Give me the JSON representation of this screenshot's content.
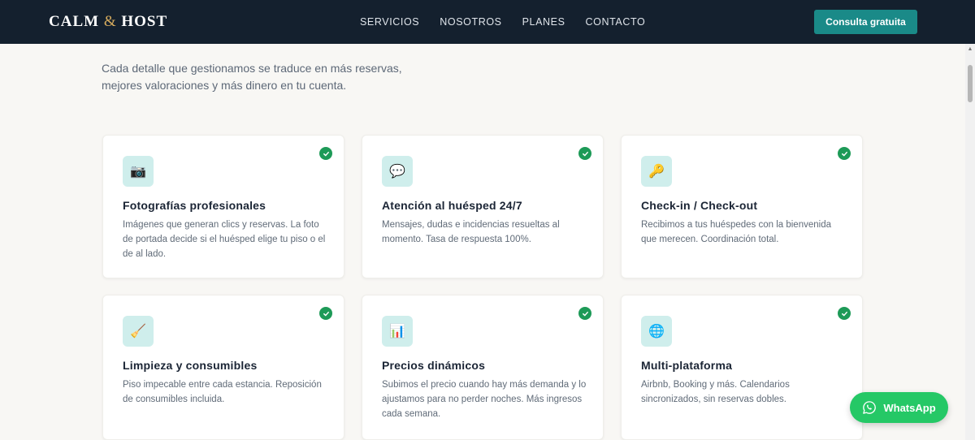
{
  "header": {
    "brand_left": "CALM",
    "brand_amp": "&",
    "brand_right": "HOST",
    "nav": [
      "SERVICIOS",
      "NOSOTROS",
      "PLANES",
      "CONTACTO"
    ],
    "cta_label": "Consulta gratuita"
  },
  "intro": {
    "text": "Cada detalle que gestionamos se traduce en más reservas, mejores valoraciones y más dinero en tu cuenta."
  },
  "cards": [
    {
      "icon": "camera-icon",
      "glyph": "📷",
      "title": "Fotografías profesionales",
      "desc": "Imágenes que generan clics y reservas. La foto de portada decide si el huésped elige tu piso o el de al lado."
    },
    {
      "icon": "speech-bubble-icon",
      "glyph": "💬",
      "title": "Atención al huésped 24/7",
      "desc": "Mensajes, dudas e incidencias resueltas al momento. Tasa de respuesta 100%."
    },
    {
      "icon": "key-icon",
      "glyph": "🔑",
      "title": "Check-in / Check-out",
      "desc": "Recibimos a tus huéspedes con la bienvenida que merecen. Coordinación total."
    },
    {
      "icon": "broom-icon",
      "glyph": "🧹",
      "title": "Limpieza y consumibles",
      "desc": "Piso impecable entre cada estancia. Reposición de consumibles incluida."
    },
    {
      "icon": "bar-chart-icon",
      "glyph": "📊",
      "title": "Precios dinámicos",
      "desc": "Subimos el precio cuando hay más demanda y lo ajustamos para no perder noches. Más ingresos cada semana."
    },
    {
      "icon": "globe-icon",
      "glyph": "🌐",
      "title": "Multi-plataforma",
      "desc": "Airbnb, Booking y más. Calendarios sincronizados, sin reservas dobles."
    }
  ],
  "whatsapp": {
    "label": "WhatsApp"
  },
  "colors": {
    "navbar": "#14202e",
    "accent": "#1a8a88",
    "gold": "#d7ac5e",
    "check": "#1d9a57",
    "whatsapp": "#25c866"
  }
}
